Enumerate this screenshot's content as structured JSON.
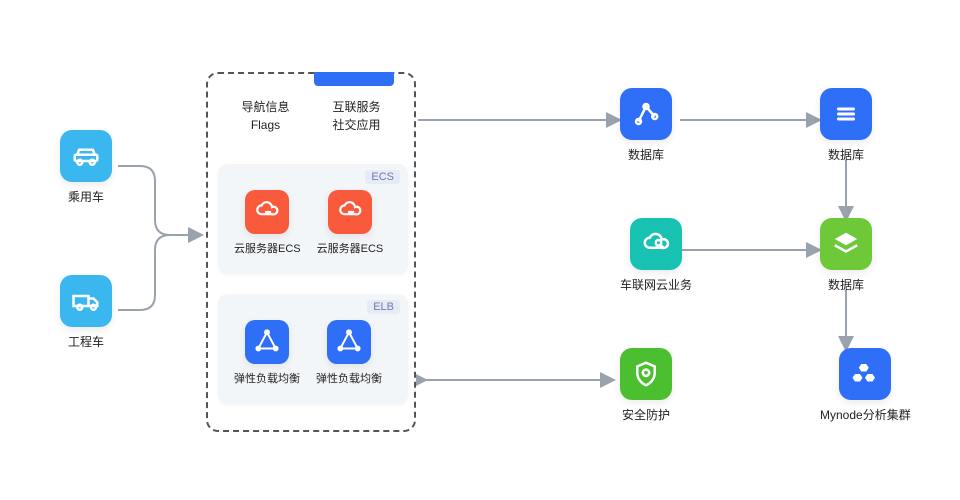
{
  "left_nodes": [
    {
      "label": "乘用车",
      "icon": "car-icon"
    },
    {
      "label": "工程车",
      "icon": "truck-icon"
    }
  ],
  "panel": {
    "tabs": [
      "导航信息\nFlags",
      "互联服务\n社交应用"
    ],
    "ecs": {
      "tag": "ECS",
      "items": [
        {
          "label": "云服务器ECS"
        },
        {
          "label": "云服务器ECS"
        }
      ]
    },
    "elb": {
      "tag": "ELB",
      "items": [
        {
          "label": "弹性负载均衡"
        },
        {
          "label": "弹性负载均衡"
        }
      ]
    }
  },
  "right_nodes": {
    "r0c0": {
      "label": "数据库",
      "icon": "graph-icon",
      "color": "blue"
    },
    "r0c1": {
      "label": "数据库",
      "icon": "bars-icon",
      "color": "blue"
    },
    "r1c0": {
      "label": "车联网云业务",
      "icon": "cloud-search-icon",
      "color": "teal"
    },
    "r1c1": {
      "label": "数据库",
      "icon": "layers-icon",
      "color": "green-light"
    },
    "r2c0": {
      "label": "安全防护",
      "icon": "shield-gear-icon",
      "color": "green"
    },
    "r2c1": {
      "label": "Mynode分析集群",
      "icon": "hex-icon",
      "color": "blue"
    }
  }
}
